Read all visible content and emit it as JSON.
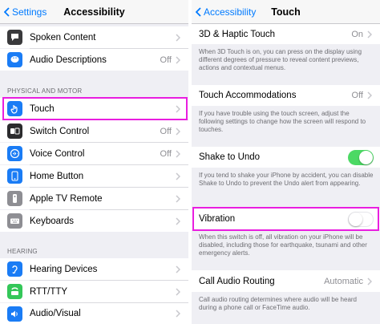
{
  "left": {
    "nav": {
      "back": "Settings",
      "title": "Accessibility"
    },
    "rows_top": [
      {
        "label": "Spoken Content",
        "value": "",
        "icon": "speech-bubble-icon",
        "color": "#3a3a3c"
      },
      {
        "label": "Audio Descriptions",
        "value": "Off",
        "icon": "quote-bubble-icon",
        "color": "#1a7cf5"
      }
    ],
    "section_physical": "PHYSICAL AND MOTOR",
    "rows_physical": [
      {
        "label": "Touch",
        "value": "",
        "icon": "hand-icon",
        "color": "#1a7cf5"
      },
      {
        "label": "Switch Control",
        "value": "Off",
        "icon": "switch-control-icon",
        "color": "#2b2b2d"
      },
      {
        "label": "Voice Control",
        "value": "Off",
        "icon": "voice-control-icon",
        "color": "#1a7cf5"
      },
      {
        "label": "Home Button",
        "value": "",
        "icon": "home-button-icon",
        "color": "#1a7cf5"
      },
      {
        "label": "Apple TV Remote",
        "value": "",
        "icon": "remote-icon",
        "color": "#8e8e93"
      },
      {
        "label": "Keyboards",
        "value": "",
        "icon": "keyboard-icon",
        "color": "#8e8e93"
      }
    ],
    "section_hearing": "HEARING",
    "rows_hearing": [
      {
        "label": "Hearing Devices",
        "value": "",
        "icon": "ear-icon",
        "color": "#1a7cf5"
      },
      {
        "label": "RTT/TTY",
        "value": "",
        "icon": "tty-icon",
        "color": "#34c759"
      },
      {
        "label": "Audio/Visual",
        "value": "",
        "icon": "speaker-icon",
        "color": "#1a7cf5"
      }
    ]
  },
  "right": {
    "nav": {
      "back": "Accessibility",
      "title": "Touch"
    },
    "haptic": {
      "label": "3D & Haptic Touch",
      "value": "On"
    },
    "haptic_footer": "When 3D Touch is on, you can press on the display using different degrees of pressure to reveal content previews, actions and contextual menus.",
    "accommodations": {
      "label": "Touch Accommodations",
      "value": "Off"
    },
    "accommodations_footer": "If you have trouble using the touch screen, adjust the following settings to change how the screen will respond to touches.",
    "shake": {
      "label": "Shake to Undo",
      "state": "on"
    },
    "shake_footer": "If you tend to shake your iPhone by accident, you can disable Shake to Undo to prevent the Undo alert from appearing.",
    "vibration": {
      "label": "Vibration",
      "state": "off"
    },
    "vibration_footer": "When this switch is off, all vibration on your iPhone will be disabled, including those for earthquake, tsunami and other emergency alerts.",
    "call_routing": {
      "label": "Call Audio Routing",
      "value": "Automatic"
    },
    "call_routing_footer": "Call audio routing determines where audio will be heard during a phone call or FaceTime audio."
  },
  "colors": {
    "accent": "#007aff",
    "highlight": "#e91ee0",
    "toggle_on": "#4cd964"
  }
}
